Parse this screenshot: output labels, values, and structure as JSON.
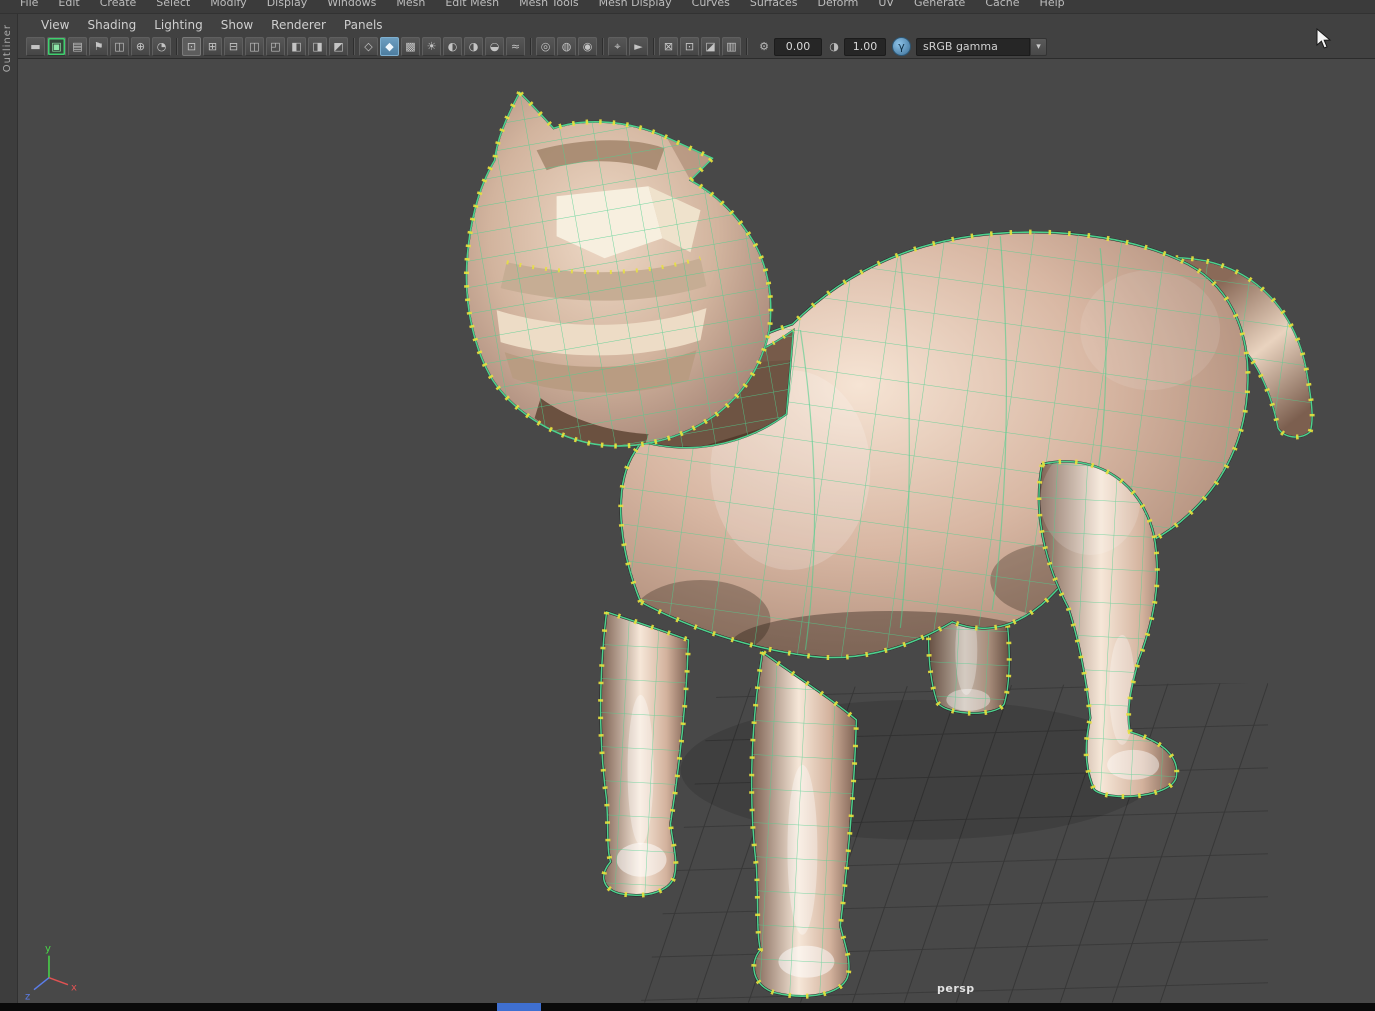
{
  "menubar": {
    "items": [
      "File",
      "Edit",
      "Create",
      "Select",
      "Modify",
      "Display",
      "Windows",
      "Mesh",
      "Edit Mesh",
      "Mesh Tools",
      "Mesh Display",
      "Curves",
      "Surfaces",
      "Deform",
      "UV",
      "Generate",
      "Cache",
      "Help"
    ]
  },
  "panel_menubar": {
    "items": [
      "View",
      "Shading",
      "Lighting",
      "Show",
      "Renderer",
      "Panels"
    ]
  },
  "sidebar": {
    "tab_label": "Outliner"
  },
  "toolbar": {
    "icons_a": [
      {
        "name": "ui-toggle-icon",
        "glyph": "▬"
      },
      {
        "name": "grease-pencil-icon",
        "glyph": "▣",
        "cls": "active-green"
      },
      {
        "name": "camera-icon",
        "glyph": "▤"
      },
      {
        "name": "bookmark-icon",
        "glyph": "⚑"
      },
      {
        "name": "image-plane-icon",
        "glyph": "◫"
      },
      {
        "name": "pan-zoom-icon",
        "glyph": "⊕"
      },
      {
        "name": "annotate-pencil-icon",
        "glyph": "◔"
      }
    ],
    "icons_b": [
      {
        "name": "single-pane-layout-icon",
        "glyph": "⊡",
        "cls": "active-soft"
      },
      {
        "name": "four-pane-layout-icon",
        "glyph": "⊞"
      },
      {
        "name": "two-pane-stacked-layout-icon",
        "glyph": "⊟"
      },
      {
        "name": "two-pane-side-layout-icon",
        "glyph": "◫"
      },
      {
        "name": "three-pane-layout-icon",
        "glyph": "◰"
      },
      {
        "name": "outliner-persp-layout-icon",
        "glyph": "◧"
      },
      {
        "name": "graph-persp-layout-icon",
        "glyph": "◨"
      },
      {
        "name": "hypershade-persp-layout-icon",
        "glyph": "◩"
      }
    ],
    "icons_c": [
      {
        "name": "wireframe-mode-icon",
        "glyph": "◇"
      },
      {
        "name": "shaded-mode-icon",
        "glyph": "◆",
        "cls": "active-blue"
      },
      {
        "name": "textured-mode-icon",
        "glyph": "▩"
      },
      {
        "name": "all-lights-icon",
        "glyph": "☀"
      },
      {
        "name": "shadows-icon",
        "glyph": "◐"
      },
      {
        "name": "ambient-occlusion-icon",
        "glyph": "◑"
      },
      {
        "name": "motion-blur-icon",
        "glyph": "◒"
      },
      {
        "name": "anti-aliasing-icon",
        "glyph": "≈"
      }
    ],
    "icons_d": [
      {
        "name": "isolate-select-icon",
        "glyph": "◎"
      },
      {
        "name": "xray-icon",
        "glyph": "◍"
      },
      {
        "name": "wireframe-on-shaded-icon",
        "glyph": "◉"
      }
    ],
    "icons_e": [
      {
        "name": "object-select-icon",
        "glyph": "⌖"
      },
      {
        "name": "lasso-select-icon",
        "glyph": "►"
      }
    ],
    "icons_f": [
      {
        "name": "frame-all-icon",
        "glyph": "⊠"
      },
      {
        "name": "frame-selection-icon",
        "glyph": "⊡"
      },
      {
        "name": "bookmark-view-icon",
        "glyph": "◪"
      },
      {
        "name": "snapshot-icon",
        "glyph": "▥"
      }
    ],
    "exposure": {
      "icon_glyph": "⚙",
      "value": "0.00"
    },
    "gamma": {
      "icon_glyph": "◑",
      "value": "1.00"
    },
    "color_management": {
      "toggle_glyph": "γ",
      "value": "sRGB gamma",
      "arrow_glyph": "▾"
    }
  },
  "viewport": {
    "camera_label": "persp",
    "axis_labels": {
      "x": "x",
      "y": "y",
      "z": "z"
    }
  },
  "colors": {
    "wireframe_green": "#4ecf8e",
    "vertex_yellow": "#e8e23e",
    "viewport_bg": "#484848",
    "selection_green": "#3fd06e",
    "active_blue": "#5285a6",
    "axis_x_red": "#e05252",
    "axis_y_green": "#49d849",
    "axis_z_blue": "#5b7de8"
  }
}
